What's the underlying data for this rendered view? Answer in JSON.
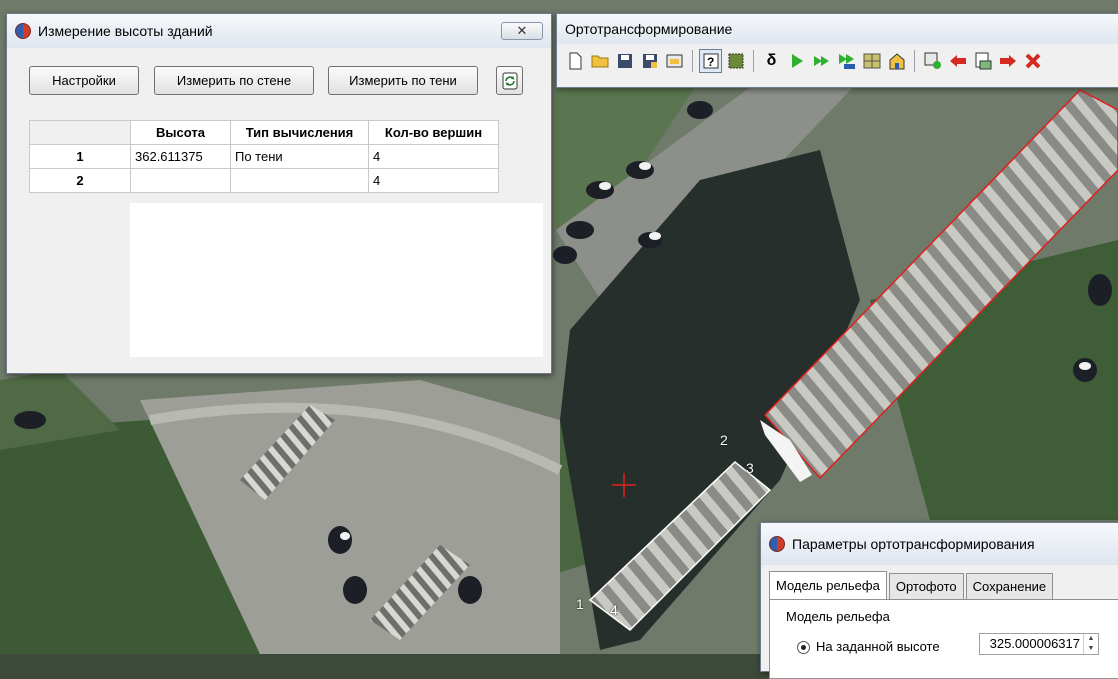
{
  "height_window": {
    "title": "Измерение высоты зданий",
    "close": "✕",
    "buttons": {
      "settings": "Настройки",
      "measure_wall": "Измерить по стене",
      "measure_shadow": "Измерить по тени"
    },
    "table": {
      "headers": [
        "Высота",
        "Тип вычисления",
        "Кол-во вершин"
      ],
      "rows": [
        {
          "n": "1",
          "height": "362.611375",
          "calc": "По тени",
          "vertices": "4"
        },
        {
          "n": "2",
          "height": "",
          "calc": "",
          "vertices": "4"
        }
      ]
    }
  },
  "ortho_window": {
    "title": "Ортотрансформирование",
    "toolbar_icons": [
      "new-file-icon",
      "open-folder-icon",
      "save-icon",
      "save-as-icon",
      "open-project-icon",
      "help-icon",
      "select-area-icon",
      "delta-icon",
      "play-icon",
      "play-all-icon",
      "play-mt-icon",
      "mosaic-icon",
      "building-icon",
      "settings-icon",
      "arrow-left-icon",
      "export-icon",
      "arrow-right-icon",
      "delete-icon"
    ],
    "delta_glyph": "δ"
  },
  "params_window": {
    "title": "Параметры ортотрансформирования",
    "tabs": [
      "Модель рельефа",
      "Ортофото",
      "Сохранение"
    ],
    "group": "Модель рельефа",
    "radio_label": "На заданной высоте",
    "height_value": "325.000006317"
  },
  "map": {
    "point_labels": [
      "1",
      "2",
      "3",
      "4"
    ],
    "colors": {
      "polygon_red": "#e0201c",
      "polygon_white": "#ffffff",
      "cross": "#e0201c"
    }
  }
}
